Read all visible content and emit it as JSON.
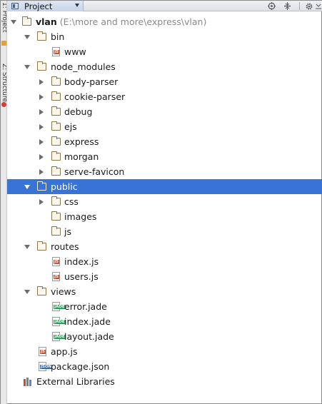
{
  "sidebar_strip": {
    "label_top": "1: Project",
    "label_bottom": "Z: Structure"
  },
  "header": {
    "tab_label": "Project",
    "icons": [
      "target-icon",
      "collapse-icon",
      "gear-icon",
      "hide-icon"
    ]
  },
  "tree": {
    "root": {
      "name": "vlan",
      "path": "(E:\\more and more\\express\\vlan)"
    },
    "bin": {
      "name": "bin",
      "children": [
        "www"
      ]
    },
    "node_modules": {
      "name": "node_modules",
      "children": [
        "body-parser",
        "cookie-parser",
        "debug",
        "ejs",
        "express",
        "morgan",
        "serve-favicon"
      ]
    },
    "public": {
      "name": "public",
      "children": [
        "css",
        "images",
        "js"
      ]
    },
    "routes": {
      "name": "routes",
      "children": [
        "index.js",
        "users.js"
      ]
    },
    "views": {
      "name": "views",
      "children": [
        "error.jade",
        "index.jade",
        "layout.jade"
      ]
    },
    "files": [
      "app.js",
      "package.json"
    ],
    "external": "External Libraries"
  },
  "file_tags": {
    "js": "JS",
    "jade": "JADE",
    "json": "JSON"
  },
  "colors": {
    "selection": "#3774d5",
    "folder": "#8a7448",
    "js": "#d14b2f",
    "jade": "#2f9c5a",
    "json": "#2f6fb0"
  }
}
